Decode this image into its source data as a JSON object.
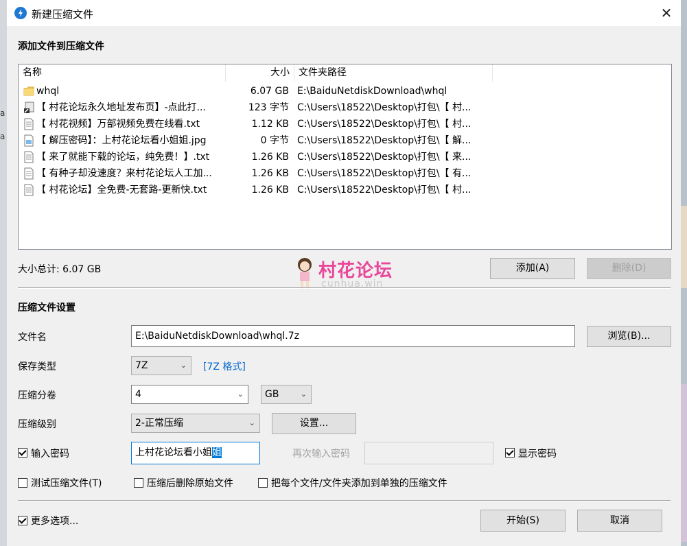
{
  "window": {
    "title": "新建压缩文件",
    "close_symbol": "✕"
  },
  "add_section": {
    "title": "添加文件到压缩文件"
  },
  "file_list": {
    "columns": [
      "名称",
      "大小",
      "文件夹路径"
    ],
    "rows": [
      {
        "icon": "folder-icon",
        "name": "whql",
        "size": "6.07 GB",
        "path": "E:\\BaiduNetdiskDownload\\whql"
      },
      {
        "icon": "shortcut-icon",
        "name": "【 村花论坛永久地址发布页】-点此打...",
        "size": "123 字节",
        "path": "C:\\Users\\18522\\Desktop\\打包\\【 村..."
      },
      {
        "icon": "text-file-icon",
        "name": "【 村花视频】万部视频免费在线看.txt",
        "size": "1.12 KB",
        "path": "C:\\Users\\18522\\Desktop\\打包\\【 村..."
      },
      {
        "icon": "image-file-icon",
        "name": "【 解压密码】：上村花论坛看小姐姐.jpg",
        "size": "0 字节",
        "path": "C:\\Users\\18522\\Desktop\\打包\\【 解..."
      },
      {
        "icon": "text-file-icon",
        "name": "【 来了就能下载的论坛，纯免费！】.txt",
        "size": "1.26 KB",
        "path": "C:\\Users\\18522\\Desktop\\打包\\【 来..."
      },
      {
        "icon": "text-file-icon",
        "name": "【 有种子却没速度？来村花论坛人工加...",
        "size": "1.26 KB",
        "path": "C:\\Users\\18522\\Desktop\\打包\\【 有..."
      },
      {
        "icon": "text-file-icon",
        "name": "【 村花论坛】全免费-无套路-更新快.txt",
        "size": "1.26 KB",
        "path": "C:\\Users\\18522\\Desktop\\打包\\【 村..."
      }
    ]
  },
  "total_size": "大小总计: 6.07 GB",
  "watermark": {
    "text": "村花论坛",
    "sub": "cunhua.win"
  },
  "buttons": {
    "add": "添加(A)",
    "delete": "删除(D)",
    "browse": "浏览(B)...",
    "settings": "设置...",
    "start": "开始(S)",
    "cancel": "取消"
  },
  "settings_section": {
    "title": "压缩文件设置"
  },
  "filename": {
    "label": "文件名",
    "value": "E:\\BaiduNetdiskDownload\\whql.7z"
  },
  "save_type": {
    "label": "保存类型",
    "value": "7Z",
    "link": "[7Z 格式]"
  },
  "split": {
    "label": "压缩分卷",
    "value": "4",
    "unit": "GB"
  },
  "level": {
    "label": "压缩级别",
    "value": "2-正常压缩"
  },
  "password": {
    "checkbox_label": "输入密码",
    "checked": true,
    "value_main": "上村花论坛看小姐",
    "value_selected": "姐",
    "repeat_label": "再次输入密码",
    "repeat_value": "",
    "show_label": "显示密码",
    "show_checked": true
  },
  "options": {
    "test": "测试压缩文件(T)",
    "delete_after": "压缩后删除原始文件",
    "separate": "把每个文件/文件夹添加到单独的压缩文件",
    "more": "更多选项..."
  }
}
